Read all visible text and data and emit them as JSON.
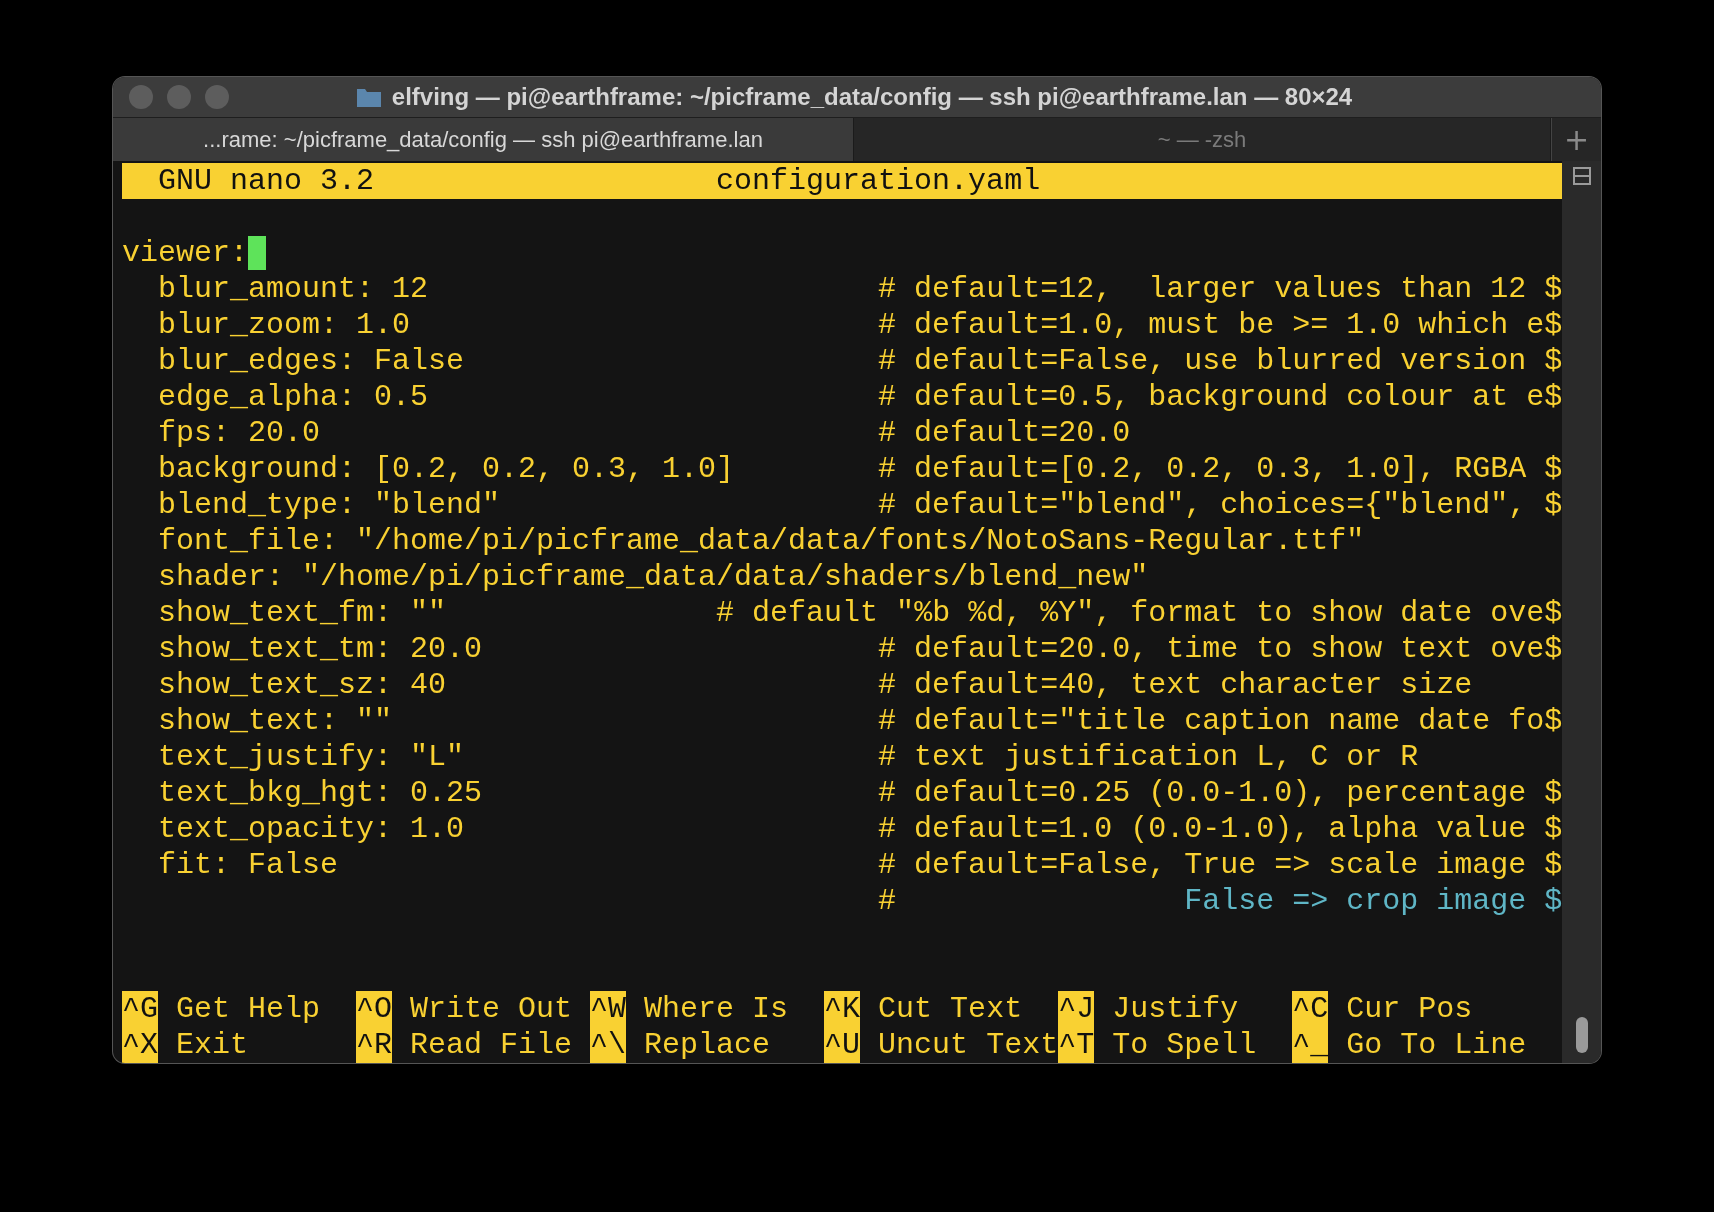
{
  "window": {
    "title": "elfving — pi@earthframe: ~/picframe_data/config — ssh pi@earthframe.lan — 80×24"
  },
  "tabs": [
    {
      "label": "...rame: ~/picframe_data/config — ssh pi@earthframe.lan",
      "selected": true
    },
    {
      "label": "~ — -zsh",
      "selected": false
    }
  ],
  "new_tab_button": "+",
  "editor": {
    "header": {
      "app": "GNU nano 3.2",
      "file": "configuration.yaml"
    },
    "lines": [
      {
        "kind": "key",
        "code": "viewer:",
        "cursor": true
      },
      {
        "kind": "setting",
        "code": "  blur_amount: 12",
        "comment": "# default=12,  larger values than 12 $"
      },
      {
        "kind": "setting",
        "code": "  blur_zoom: 1.0",
        "comment": "# default=1.0, must be >= 1.0 which e$"
      },
      {
        "kind": "setting",
        "code": "  blur_edges: False",
        "comment": "# default=False, use blurred version $"
      },
      {
        "kind": "setting",
        "code": "  edge_alpha: 0.5",
        "comment": "# default=0.5, background colour at e$"
      },
      {
        "kind": "setting",
        "code": "  fps: 20.0",
        "comment": "# default=20.0"
      },
      {
        "kind": "setting",
        "code": "  background: [0.2, 0.2, 0.3, 1.0]",
        "comment": "# default=[0.2, 0.2, 0.3, 1.0], RGBA $"
      },
      {
        "kind": "setting",
        "code": "  blend_type: \"blend\"",
        "comment": "# default=\"blend\", choices={\"blend\", $"
      },
      {
        "kind": "plain",
        "code": "  font_file: \"/home/pi/picframe_data/data/fonts/NotoSans-Regular.ttf\""
      },
      {
        "kind": "plain",
        "code": "  shader: \"/home/pi/picframe_data/data/shaders/blend_new\""
      },
      {
        "kind": "setting_near",
        "code": "  show_text_fm: \"\"",
        "comment": "# default \"%b %d, %Y\", format to show date ove$"
      },
      {
        "kind": "setting",
        "code": "  show_text_tm: 20.0",
        "comment": "# default=20.0, time to show text ove$"
      },
      {
        "kind": "setting",
        "code": "  show_text_sz: 40",
        "comment": "# default=40, text character size"
      },
      {
        "kind": "setting",
        "code": "  show_text: \"\"",
        "comment": "# default=\"title caption name date fo$"
      },
      {
        "kind": "setting",
        "code": "  text_justify: \"L\"",
        "comment": "# text justification L, C or R"
      },
      {
        "kind": "setting",
        "code": "  text_bkg_hgt: 0.25",
        "comment": "# default=0.25 (0.0-1.0), percentage $"
      },
      {
        "kind": "setting",
        "code": "  text_opacity: 1.0",
        "comment": "# default=1.0 (0.0-1.0), alpha value $"
      },
      {
        "kind": "setting",
        "code": "  fit: False",
        "comment": "# default=False, True => scale image $"
      },
      {
        "kind": "note",
        "comment": "#",
        "note": "False => crop image $"
      }
    ],
    "shortcuts": [
      [
        {
          "key": "^G",
          "label": "Get Help"
        },
        {
          "key": "^O",
          "label": "Write Out"
        },
        {
          "key": "^W",
          "label": "Where Is"
        },
        {
          "key": "^K",
          "label": "Cut Text"
        },
        {
          "key": "^J",
          "label": "Justify"
        },
        {
          "key": "^C",
          "label": "Cur Pos"
        }
      ],
      [
        {
          "key": "^X",
          "label": "Exit"
        },
        {
          "key": "^R",
          "label": "Read File"
        },
        {
          "key": "^\\",
          "label": "Replace"
        },
        {
          "key": "^U",
          "label": "Uncut Text"
        },
        {
          "key": "^T",
          "label": "To Spell"
        },
        {
          "key": "^_",
          "label": "Go To Line"
        }
      ]
    ]
  }
}
